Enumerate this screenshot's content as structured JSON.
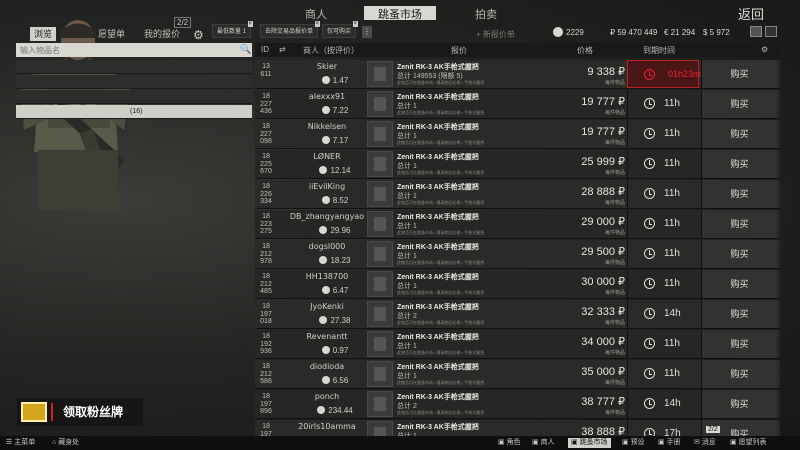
{
  "nav": {
    "trader_label": "商人",
    "flea_label": "跳蚤市场",
    "handbook_label": "拍卖",
    "back_label": "返回"
  },
  "left": {
    "tabs": [
      "浏览",
      "愿望单",
      "我的报价"
    ],
    "offer_count": "2/2",
    "filters": [
      "最低数量 1",
      "去除交易品报价单",
      "仅可购买"
    ],
    "search_placeholder": "输入物品名",
    "selected_category": "(16)"
  },
  "header": {
    "add_offer": "+ 新报价单",
    "rating": "2229",
    "roubles": "₽ 59 470 449",
    "euros": "€ 21 294",
    "dollars": "$ 5 972",
    "col_id": "ID",
    "col_seller": "商人（按评价）",
    "col_offer": "报价",
    "col_price": "价格",
    "col_expires": "到期时间"
  },
  "item_name": "Zenit RK-3 AK手枪式握把",
  "item_sub": "此物品可在跳蚤市场 • 最高物品价格 • 手枪式握把",
  "each_label": "每件物品",
  "buy_label": "购买",
  "offers": [
    {
      "id": [
        "13",
        "611"
      ],
      "seller": "Skier",
      "rating": "1.47",
      "total": "总计 149553 (限额 5)",
      "price": "9 338 ₽",
      "time": "01h23m",
      "urgent": true
    },
    {
      "id": [
        "18",
        "227",
        "436"
      ],
      "seller": "alexxx91",
      "rating": "7.22",
      "total": "总计 1",
      "price": "19 777 ₽",
      "time": "11h",
      "urgent": false
    },
    {
      "id": [
        "18",
        "227",
        "098"
      ],
      "seller": "Nikkelsen",
      "rating": "7.17",
      "total": "总计 1",
      "price": "19 777 ₽",
      "time": "11h",
      "urgent": false
    },
    {
      "id": [
        "18",
        "225",
        "670"
      ],
      "seller": "LØNER",
      "rating": "12.14",
      "total": "总计 1",
      "price": "25 999 ₽",
      "time": "11h",
      "urgent": false
    },
    {
      "id": [
        "18",
        "226",
        "334"
      ],
      "seller": "iiEvilKing",
      "rating": "8.52",
      "total": "总计 1",
      "price": "28 888 ₽",
      "time": "11h",
      "urgent": false
    },
    {
      "id": [
        "18",
        "223",
        "275"
      ],
      "seller": "DB_zhangyangyao",
      "rating": "29.96",
      "total": "总计 1",
      "price": "29 000 ₽",
      "time": "11h",
      "urgent": false
    },
    {
      "id": [
        "18",
        "212",
        "978"
      ],
      "seller": "dogsl000",
      "rating": "18.23",
      "total": "总计 1",
      "price": "29 500 ₽",
      "time": "11h",
      "urgent": false
    },
    {
      "id": [
        "18",
        "212",
        "485"
      ],
      "seller": "HH138700",
      "rating": "6.47",
      "total": "总计 1",
      "price": "30 000 ₽",
      "time": "11h",
      "urgent": false
    },
    {
      "id": [
        "18",
        "197",
        "018"
      ],
      "seller": "JyoKenki",
      "rating": "27.38",
      "total": "总计 2",
      "price": "32 333 ₽",
      "time": "14h",
      "urgent": false
    },
    {
      "id": [
        "18",
        "192",
        "936"
      ],
      "seller": "Revenantt",
      "rating": "0.97",
      "total": "总计 1",
      "price": "34 000 ₽",
      "time": "11h",
      "urgent": false
    },
    {
      "id": [
        "18",
        "212",
        "586"
      ],
      "seller": "diodioda",
      "rating": "6.56",
      "total": "总计 1",
      "price": "35 000 ₽",
      "time": "11h",
      "urgent": false
    },
    {
      "id": [
        "18",
        "197",
        "896"
      ],
      "seller": "ponch",
      "rating": "234.44",
      "total": "总计 2",
      "price": "38 777 ₽",
      "time": "14h",
      "urgent": false
    },
    {
      "id": [
        "18",
        "197",
        ""
      ],
      "seller": "20irls10amma",
      "rating": "",
      "total": "总计 1",
      "price": "38 888 ₽",
      "time": "17h",
      "urgent": false
    }
  ],
  "overlay": {
    "fan_text": "领取粉丝牌"
  },
  "page_badge": "2/2",
  "bottom": {
    "main_menu": "主菜单",
    "hideout": "藏身处",
    "character": "角色",
    "traders": "商人",
    "flea": "跳蚤市场",
    "builds": "预设",
    "handbook": "手册",
    "messenger": "消息",
    "watchlist": "愿望列表"
  }
}
